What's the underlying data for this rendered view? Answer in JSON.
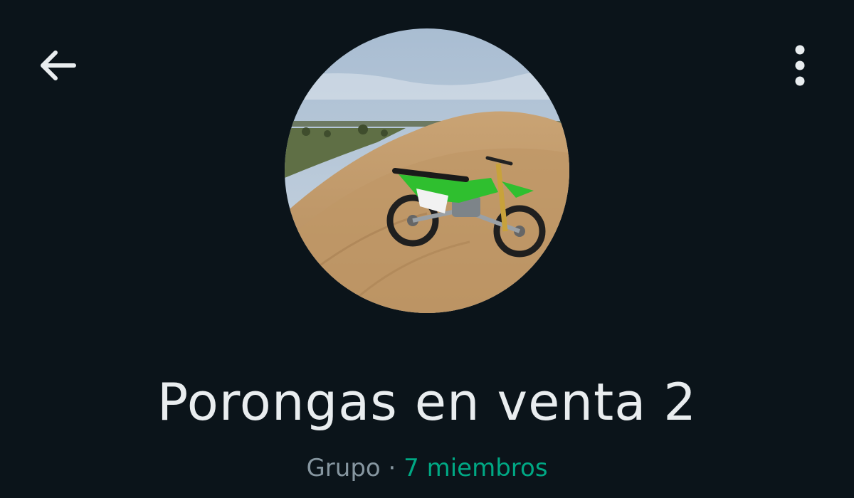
{
  "header": {
    "back_icon": "arrow-left-icon",
    "menu_icon": "more-vertical-icon"
  },
  "profile": {
    "avatar_subject": "dirt-bike-on-sand-dune",
    "name": "Porongas en venta 2",
    "type_label": "Grupo",
    "separator": " · ",
    "members_label": "7 miembros"
  },
  "colors": {
    "background": "#0b141a",
    "title_text": "#e9edef",
    "secondary_text": "#8696a0",
    "accent": "#00a884"
  }
}
